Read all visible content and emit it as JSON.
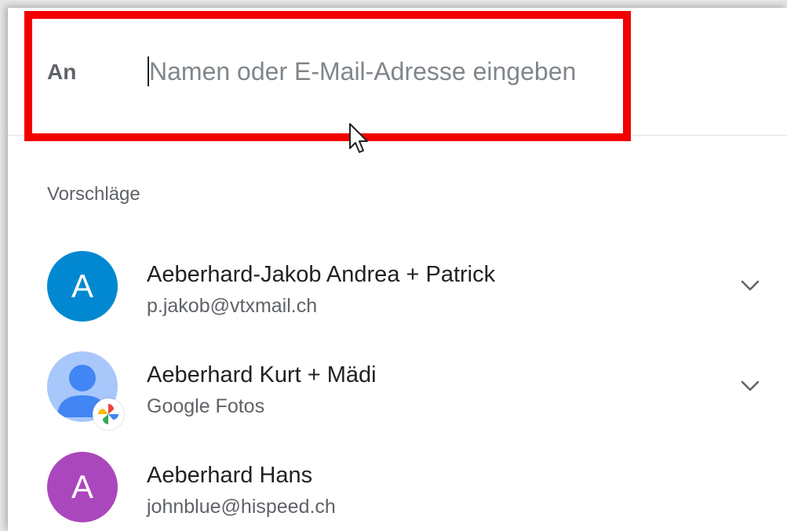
{
  "recipient_field": {
    "label": "An",
    "placeholder": "Namen oder E-Mail-Adresse eingeben",
    "value": ""
  },
  "suggestions": {
    "header": "Vorschläge",
    "contacts": [
      {
        "name": "Aeberhard-Jakob Andrea + Patrick",
        "subtitle": "p.jakob@vtxmail.ch",
        "initial": "A",
        "avatar_color": "#0288d1",
        "avatar_type": "initial",
        "has_expand": true
      },
      {
        "name": "Aeberhard Kurt + Mädi",
        "subtitle": "Google Fotos",
        "initial": "",
        "avatar_color": "#a8c7fa",
        "avatar_type": "person-silhouette-icon",
        "has_expand": true
      },
      {
        "name": "Aeberhard Hans",
        "subtitle": "johnblue@hispeed.ch",
        "initial": "A",
        "avatar_color": "#ab47bc",
        "avatar_type": "initial",
        "has_expand": false
      }
    ]
  },
  "colors": {
    "highlight": "#f20000",
    "primary_text": "#202124",
    "secondary_text": "#5f6368"
  }
}
